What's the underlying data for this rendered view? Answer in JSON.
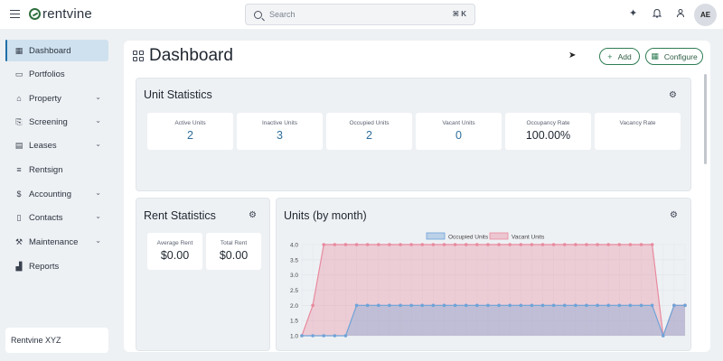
{
  "app": {
    "name": "rentvine"
  },
  "search": {
    "placeholder": "Search",
    "shortcut": "⌘ K"
  },
  "user": {
    "initials": "AE"
  },
  "sidebar": {
    "items": [
      {
        "label": "Dashboard",
        "icon": "grid-icon",
        "active": true
      },
      {
        "label": "Portfolios",
        "icon": "folder-icon"
      },
      {
        "label": "Property",
        "icon": "home-icon",
        "expandable": true
      },
      {
        "label": "Screening",
        "icon": "document-search-icon",
        "expandable": true
      },
      {
        "label": "Leases",
        "icon": "lease-icon",
        "expandable": true
      },
      {
        "label": "Rentsign",
        "icon": "signature-icon"
      },
      {
        "label": "Accounting",
        "icon": "dollar-icon",
        "expandable": true
      },
      {
        "label": "Contacts",
        "icon": "contacts-icon",
        "expandable": true
      },
      {
        "label": "Maintenance",
        "icon": "wrench-icon",
        "expandable": true
      },
      {
        "label": "Reports",
        "icon": "chart-icon"
      }
    ],
    "organization": "Rentvine XYZ"
  },
  "page": {
    "title": "Dashboard",
    "add_label": "Add",
    "configure_label": "Configure"
  },
  "unit_statistics": {
    "title": "Unit Statistics",
    "cards": [
      {
        "label": "Active Units",
        "value": "2"
      },
      {
        "label": "Inactive Units",
        "value": "3"
      },
      {
        "label": "Occupied Units",
        "value": "2"
      },
      {
        "label": "Vacant Units",
        "value": "0"
      },
      {
        "label": "Occupancy Rate",
        "value": "100.00%"
      },
      {
        "label": "Vacancy Rate",
        "value": ""
      }
    ]
  },
  "rent_statistics": {
    "title": "Rent Statistics",
    "cards": [
      {
        "label": "Average Rent",
        "value": "$0.00"
      },
      {
        "label": "Total Rent",
        "value": "$0.00"
      }
    ]
  },
  "units_chart": {
    "title": "Units (by month)"
  },
  "colors": {
    "accent": "#2f7d55",
    "active_nav": "#cfe1ee",
    "occupied": "#6fa3d8",
    "vacant": "#e88a9e"
  },
  "chart_data": {
    "type": "area",
    "title": "Units (by month)",
    "xlabel": "",
    "ylabel": "",
    "ylim": [
      1.0,
      4.0
    ],
    "y_ticks": [
      "1.0",
      "1.5",
      "2.0",
      "2.5",
      "3.0",
      "3.5",
      "4.0"
    ],
    "legend_position": "top",
    "grid": true,
    "series": [
      {
        "name": "Occupied Units",
        "color": "#6fa3d8",
        "values": [
          1,
          1,
          1,
          1,
          1,
          2,
          2,
          2,
          2,
          2,
          2,
          2,
          2,
          2,
          2,
          2,
          2,
          2,
          2,
          2,
          2,
          2,
          2,
          2,
          2,
          2,
          2,
          2,
          2,
          2,
          2,
          2,
          2,
          1,
          2,
          2
        ]
      },
      {
        "name": "Vacant Units",
        "color": "#e88a9e",
        "values": [
          1,
          2,
          4,
          4,
          4,
          4,
          4,
          4,
          4,
          4,
          4,
          4,
          4,
          4,
          4,
          4,
          4,
          4,
          4,
          4,
          4,
          4,
          4,
          4,
          4,
          4,
          4,
          4,
          4,
          4,
          4,
          4,
          4,
          1,
          2,
          2
        ]
      }
    ]
  }
}
